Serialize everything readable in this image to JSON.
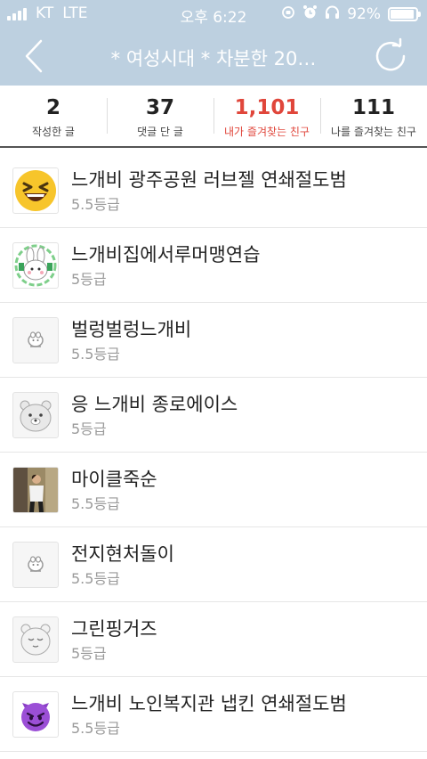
{
  "status_bar": {
    "carrier": "KT",
    "network": "LTE",
    "time": "오후 6:22",
    "battery_text": "92%",
    "battery_level": 0.92
  },
  "header": {
    "title": "* 여성시대 *  차분한 20…",
    "background_color": "#bdd0e0"
  },
  "stats": [
    {
      "value": "2",
      "label": "작성한 글"
    },
    {
      "value": "37",
      "label": "댓글 단 글"
    },
    {
      "value": "1,101",
      "label": "내가 즐겨찾는 친구",
      "active": true
    },
    {
      "value": "111",
      "label": "나를 즐겨찾는 친구"
    }
  ],
  "accent_color": "#e0463b",
  "friends": [
    {
      "name": "느개비 광주공원 러브젤 연쇄절도범",
      "grade": "5.5등급",
      "avatar": "laughing-emoji-icon"
    },
    {
      "name": "느개비집에서루머맹연습",
      "grade": "5등급",
      "avatar": "bunny-character-icon"
    },
    {
      "name": "벌렁벌렁느개비",
      "grade": "5.5등급",
      "avatar": "default-profile-icon"
    },
    {
      "name": "응 느개비 종로에이스",
      "grade": "5등급",
      "avatar": "bear-character-icon"
    },
    {
      "name": "마이클죽순",
      "grade": "5.5등급",
      "avatar": "photo-avatar"
    },
    {
      "name": "전지현처돌이",
      "grade": "5.5등급",
      "avatar": "default-profile-icon"
    },
    {
      "name": "그린핑거즈",
      "grade": "5등급",
      "avatar": "sleepy-bear-icon"
    },
    {
      "name": "느개비 노인복지관 냅킨 연쇄절도범",
      "grade": "5.5등급",
      "avatar": "devil-emoji-icon"
    }
  ]
}
